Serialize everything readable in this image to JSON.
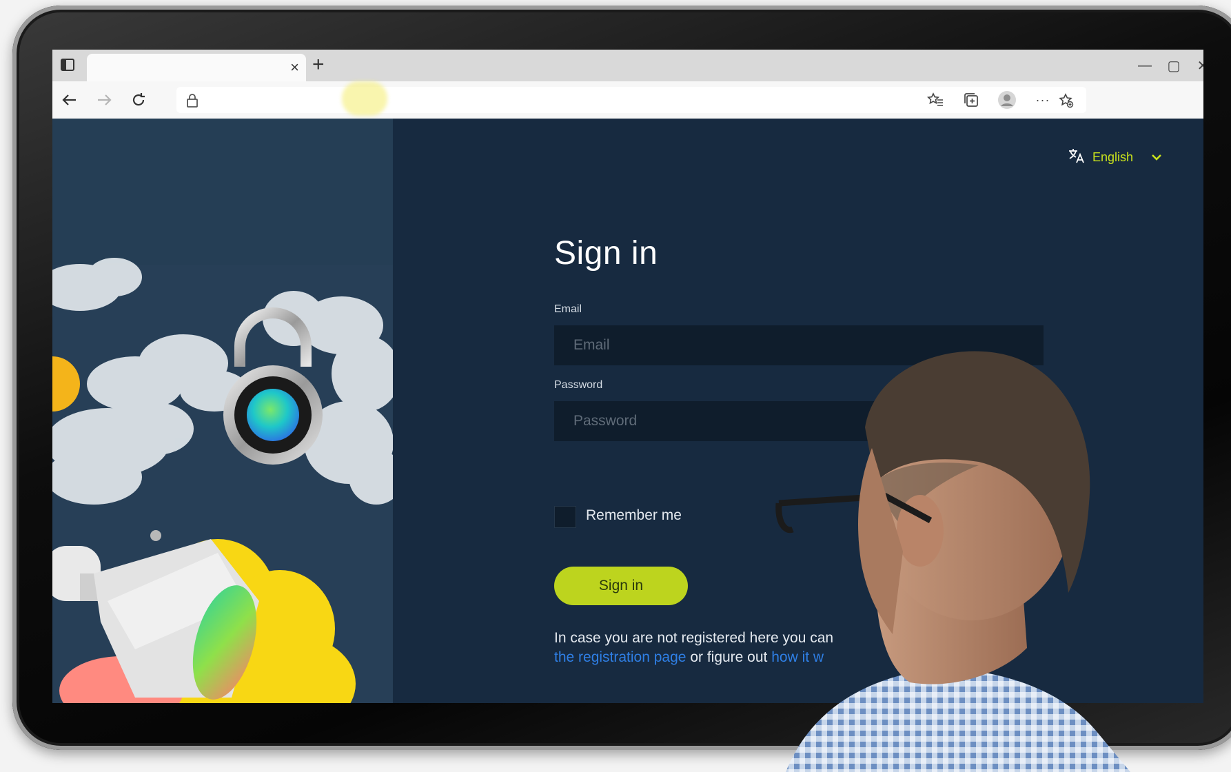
{
  "browser": {
    "tab": {
      "title": "",
      "close_glyph": "×"
    },
    "new_tab_glyph": "+",
    "window_controls": {
      "minimize": "—",
      "maximize": "▢",
      "close": "✕"
    },
    "address": {
      "url": ""
    },
    "nav_icons": [
      "back-arrow-icon",
      "forward-arrow-icon",
      "refresh-icon"
    ],
    "toolbar_icons": [
      "add-favorite-icon",
      "favorites-icon",
      "collections-icon",
      "profile-icon",
      "more-icon"
    ],
    "more_glyph": "···"
  },
  "page": {
    "language": {
      "label": "English"
    },
    "title": "Sign in",
    "email": {
      "label": "Email",
      "placeholder": "Email"
    },
    "password": {
      "label": "Password",
      "placeholder": "Password"
    },
    "remember": {
      "label": "Remember me"
    },
    "signin_button": "Sign in",
    "info": {
      "prefix": "In case you are not registered here you can",
      "link_register": "the registration page",
      "middle": "or figure out",
      "link_how": "how it w"
    }
  },
  "colors": {
    "accent": "#bdd41e",
    "language_text": "#c9e21c",
    "panel_dark": "#172a40",
    "panel_left": "#273f57",
    "link": "#2f7fe5"
  }
}
